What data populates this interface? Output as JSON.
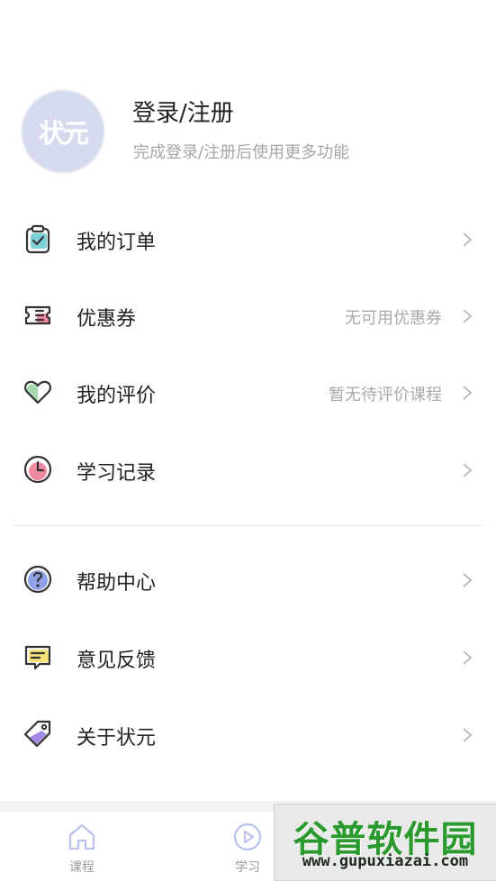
{
  "profile": {
    "avatar_text": "状元",
    "title": "登录/注册",
    "subtitle": "完成登录/注册后使用更多功能"
  },
  "menu": [
    {
      "label": "我的订单",
      "value": "",
      "icon": "order-clipboard-icon"
    },
    {
      "label": "优惠券",
      "value": "无可用优惠券",
      "icon": "coupon-ticket-icon"
    },
    {
      "label": "我的评价",
      "value": "暂无待评价课程",
      "icon": "heart-icon"
    },
    {
      "label": "学习记录",
      "value": "",
      "icon": "clock-icon"
    },
    {
      "label": "帮助中心",
      "value": "",
      "icon": "help-question-icon"
    },
    {
      "label": "意见反馈",
      "value": "",
      "icon": "feedback-message-icon"
    },
    {
      "label": "关于状元",
      "value": "",
      "icon": "tag-icon"
    }
  ],
  "tabbar": {
    "tabs": [
      {
        "label": "课程",
        "icon": "home-icon"
      },
      {
        "label": "学习",
        "icon": "play-circle-icon"
      }
    ]
  },
  "watermark": {
    "title": "谷普软件园",
    "url": "www.gupuxiazai.com"
  },
  "colors": {
    "avatar_bg": "#d6daee",
    "text_primary": "#222222",
    "text_secondary": "#a9a9a9",
    "icon_stroke": "#333333",
    "icon_teal": "#7dd0d8",
    "icon_pink": "#f08aa0",
    "icon_green": "#a7d8b0",
    "icon_blue": "#8fa0e8",
    "icon_yellow": "#f5e27a",
    "icon_purple": "#a58be8"
  }
}
